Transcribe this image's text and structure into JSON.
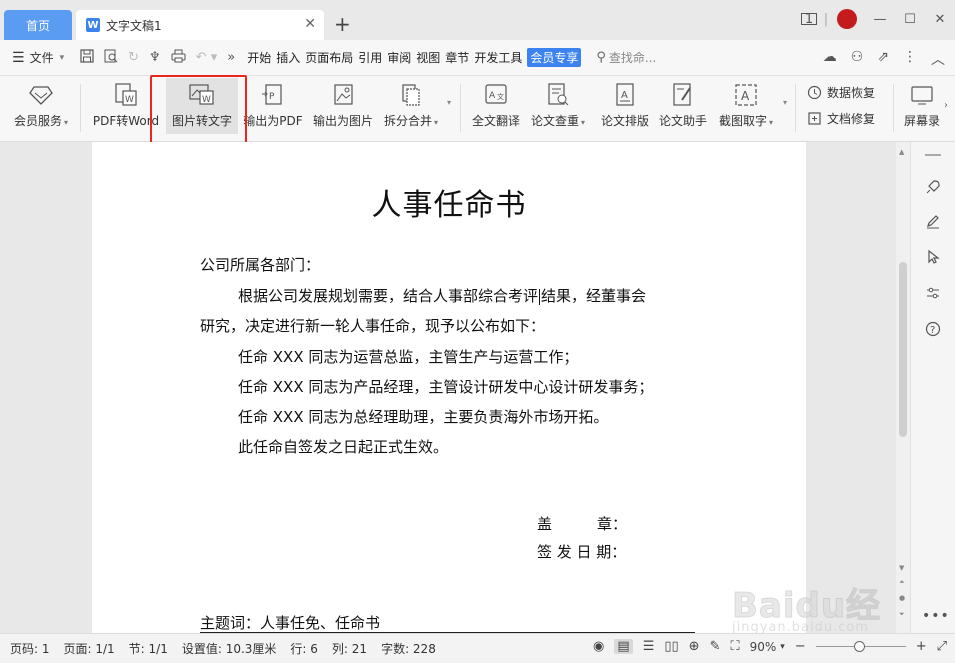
{
  "tabs": {
    "home_label": "首页",
    "doc_icon": "W",
    "doc_title": "文字文稿1",
    "close": "✕",
    "add": "+"
  },
  "window": {
    "page_count": "1"
  },
  "menubar": {
    "file_label": "文件",
    "tabs": [
      "开始",
      "插入",
      "页面布局",
      "引用",
      "审阅",
      "视图",
      "章节",
      "开发工具",
      "会员专享"
    ],
    "search_placeholder": "查找命..."
  },
  "ribbon": {
    "member_service": "会员服务",
    "pdf_to_word": "PDF转Word",
    "image_to_text": "图片转文字",
    "export_pdf": "输出为PDF",
    "export_image": "输出为图片",
    "split_merge": "拆分合并",
    "full_translate": "全文翻译",
    "paper_check": "论文查重",
    "paper_layout": "论文排版",
    "paper_assistant": "论文助手",
    "screenshot_ocr": "截图取字",
    "data_recovery": "数据恢复",
    "doc_repair": "文档修复",
    "screen_record": "屏幕录"
  },
  "document": {
    "title": "人事任命书",
    "greeting": "公司所属各部门：",
    "para1_a": "根据公司发展规划需要，结合人事部综合考评",
    "para1_b": "结果，经董事会",
    "para1_cont": "研究，决定进行新一轮人事任命，现予以公布如下：",
    "item1": "任命 XXX 同志为运营总监，主管生产与运营工作；",
    "item2": "任命 XXX 同志为产品经理，主管设计研发中心设计研发事务；",
    "item3": "任命 XXX 同志为总经理助理，主要负责海外市场开拓。",
    "effective": "此任命自签发之日起正式生效。",
    "seal": "盖　　　章：",
    "sign_date": "签 发 日 期：",
    "subject": "主题词：人事任免、任命书"
  },
  "status": {
    "page": "页码: 1",
    "pages": "页面: 1/1",
    "section": "节: 1/1",
    "setting": "设置值: 10.3厘米",
    "row": "行: 6",
    "col": "列: 21",
    "words": "字数: 228",
    "zoom": "90%"
  },
  "watermark": {
    "main": "Baidu经验",
    "sub": "jingyan.baidu.com"
  }
}
